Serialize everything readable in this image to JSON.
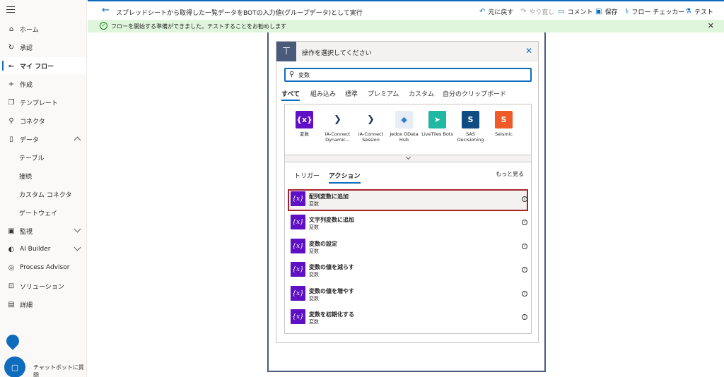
{
  "sidebar": {
    "items": [
      {
        "label": "ホーム",
        "icon": "home-icon"
      },
      {
        "label": "承認",
        "icon": "approvals-icon"
      },
      {
        "label": "マイ フロー",
        "icon": "flow-icon"
      },
      {
        "label": "作成",
        "icon": "plus-icon"
      },
      {
        "label": "テンプレート",
        "icon": "templates-icon"
      },
      {
        "label": "コネクタ",
        "icon": "connector-icon"
      },
      {
        "label": "データ",
        "icon": "database-icon"
      },
      {
        "label": "テーブル"
      },
      {
        "label": "接続"
      },
      {
        "label": "カスタム コネクタ"
      },
      {
        "label": "ゲートウェイ"
      },
      {
        "label": "監視",
        "icon": "monitor-icon"
      },
      {
        "label": "AI Builder",
        "icon": "ai-builder-icon"
      },
      {
        "label": "Process Advisor",
        "icon": "process-advisor-icon"
      },
      {
        "label": "ソリューション",
        "icon": "solutions-icon"
      },
      {
        "label": "詳細",
        "icon": "book-icon"
      }
    ],
    "chatbot_label": "チャットボットに質問"
  },
  "header": {
    "title": "スプレッドシートから取得した一覧データをBOTの入力値(グループデータ)として実行",
    "undo": "元に戻す",
    "redo": "やり直し",
    "comment": "コメント",
    "save": "保存",
    "flow_checker": "フロー チェッカー",
    "test": "テスト"
  },
  "notification": {
    "text": "フローを開始する準備ができました。テストすることをお勧めします"
  },
  "dialog": {
    "title": "操作を選択してください",
    "search_value": "変数",
    "category_tabs": [
      "すべて",
      "組み込み",
      "標準",
      "プレミアム",
      "カスタム",
      "自分のクリップボード"
    ],
    "connectors": [
      {
        "label": "変数",
        "color": "#5f0fc4",
        "glyph": "{x}"
      },
      {
        "label": "IA-Connect Dynamic...",
        "color": "#ffffff",
        "glyph": "❯"
      },
      {
        "label": "IA-Connect Session",
        "color": "#ffffff",
        "glyph": "❯"
      },
      {
        "label": "Jedox OData Hub",
        "color": "#e8edf5",
        "glyph": "◆"
      },
      {
        "label": "LiveTiles Bots",
        "color": "#21b8a3",
        "glyph": "➤"
      },
      {
        "label": "SAS Decisioning",
        "color": "#0f4c81",
        "glyph": "S"
      },
      {
        "label": "Seismic",
        "color": "#f05a28",
        "glyph": "S"
      }
    ],
    "result_tabs": [
      "トリガー",
      "アクション"
    ],
    "see_more": "もっと見る",
    "actions": [
      {
        "name": "配列変数に追加",
        "sub": "変数"
      },
      {
        "name": "文字列変数に追加",
        "sub": "変数"
      },
      {
        "name": "変数の設定",
        "sub": "変数"
      },
      {
        "name": "変数の値を減らす",
        "sub": "変数"
      },
      {
        "name": "変数の値を増やす",
        "sub": "変数"
      },
      {
        "name": "変数を初期化する",
        "sub": "変数"
      }
    ]
  }
}
